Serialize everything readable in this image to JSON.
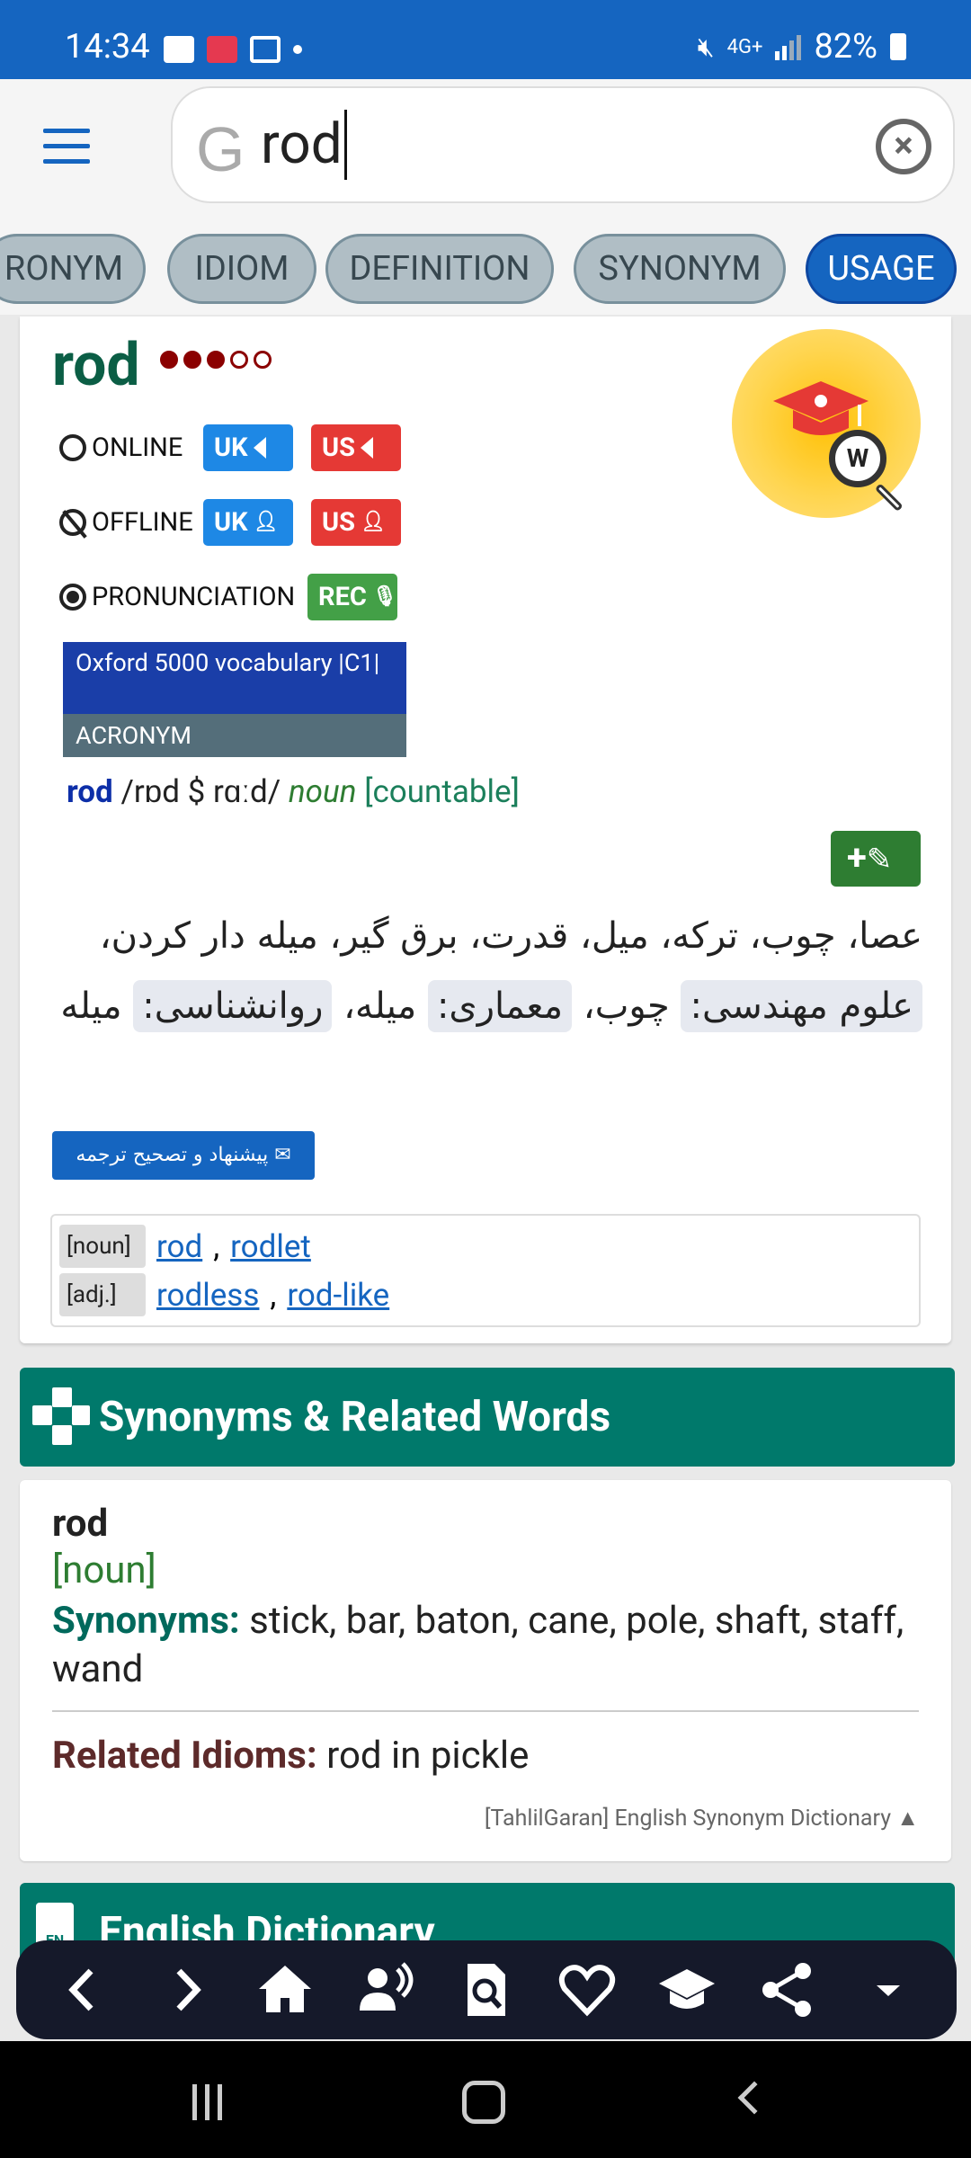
{
  "status_bar": {
    "time": "14:34",
    "network": "4G+",
    "battery": "82%"
  },
  "search": {
    "logo": "G",
    "query": "rod",
    "clear_icon": "close-circle-icon"
  },
  "tabs": [
    {
      "label": "RONYM"
    },
    {
      "label": "IDIOM"
    },
    {
      "label": "DEFINITION"
    },
    {
      "label": "SYNONYM"
    },
    {
      "label": "USAGE",
      "active": true
    }
  ],
  "entry": {
    "word": "rod",
    "frequency_level": 3,
    "frequency_max": 5,
    "online_label": "ONLINE",
    "offline_label": "OFFLINE",
    "pronunciation_label": "PRONUNCIATION",
    "uk": "UK",
    "us": "US",
    "rec": "REC",
    "vocab_tag": "Oxford 5000 vocabulary |C1|",
    "acronym_tag": "ACRONYM",
    "headword": "rod",
    "phonetic": "/rɒd $ rɑːd/",
    "pos": "noun",
    "countable": "[countable]",
    "add_note": "+",
    "persian_main": "عصا، چوب، ترکه، میل، قدرت، برق گیر، میله دار کردن،",
    "persian_tag1": "علوم مهندسی:",
    "persian_val1": "چوب،",
    "persian_tag2": "معماری:",
    "persian_val2": "میله،",
    "persian_tag3": "روانشناسی:",
    "persian_val3": "میله",
    "suggest_label": "پیشنهاد و تصحیح ترجمه",
    "forms": [
      {
        "pos": "[noun]",
        "words": [
          "rod",
          "rodlet"
        ]
      },
      {
        "pos": "[adj.]",
        "words": [
          "rodless",
          "rod-like"
        ]
      }
    ]
  },
  "synonyms_section": {
    "title": "Synonyms & Related Words",
    "word": "rod",
    "pos": "[noun]",
    "syn_label": "Synonyms:",
    "syn_list": "stick, bar, baton, cane, pole, shaft, staff, wand",
    "idioms_label": "Related Idioms:",
    "idioms": "rod in pickle",
    "source": "[TahlilGaran] English Synonym Dictionary ▲"
  },
  "english_dictionary": {
    "title": "English Dictionary",
    "icon_text": "EN"
  },
  "colors": {
    "status_bar": "#1565c0",
    "accent_teal": "#00796b",
    "headword_green": "#0b5e45",
    "active_tab": "#1565c0"
  }
}
